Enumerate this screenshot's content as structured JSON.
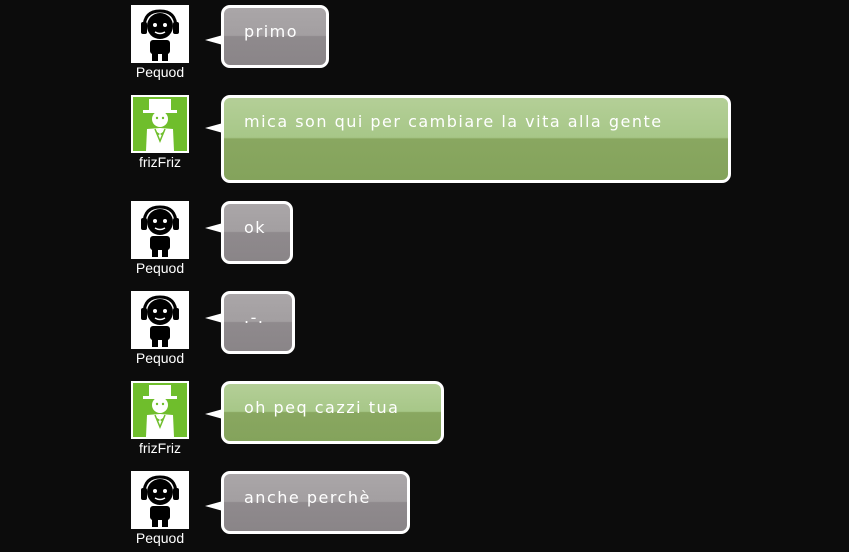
{
  "users": {
    "pequod": {
      "name": "Pequod",
      "avatar_icon": "headphones-person-icon",
      "avatar_bg": "#ffffff"
    },
    "frizfriz": {
      "name": "frizFriz",
      "avatar_icon": "top-hat-gentleman-icon",
      "avatar_bg": "#6fbe2c"
    }
  },
  "colors": {
    "background": "#0c0c0c",
    "bubble_gray": "#9a9698",
    "bubble_green": "#96b672",
    "bubble_border": "#ffffff"
  },
  "messages": [
    {
      "user": "Pequod",
      "text": "primo",
      "style": "gray"
    },
    {
      "user": "frizFriz",
      "text": "mica son qui per cambiare la vita alla gente",
      "style": "green"
    },
    {
      "user": "Pequod",
      "text": "ok",
      "style": "gray"
    },
    {
      "user": "Pequod",
      "text": ".-.",
      "style": "gray"
    },
    {
      "user": "frizFriz",
      "text": "oh peq cazzi tua",
      "style": "green"
    },
    {
      "user": "Pequod",
      "text": "anche perchè",
      "style": "gray"
    }
  ]
}
